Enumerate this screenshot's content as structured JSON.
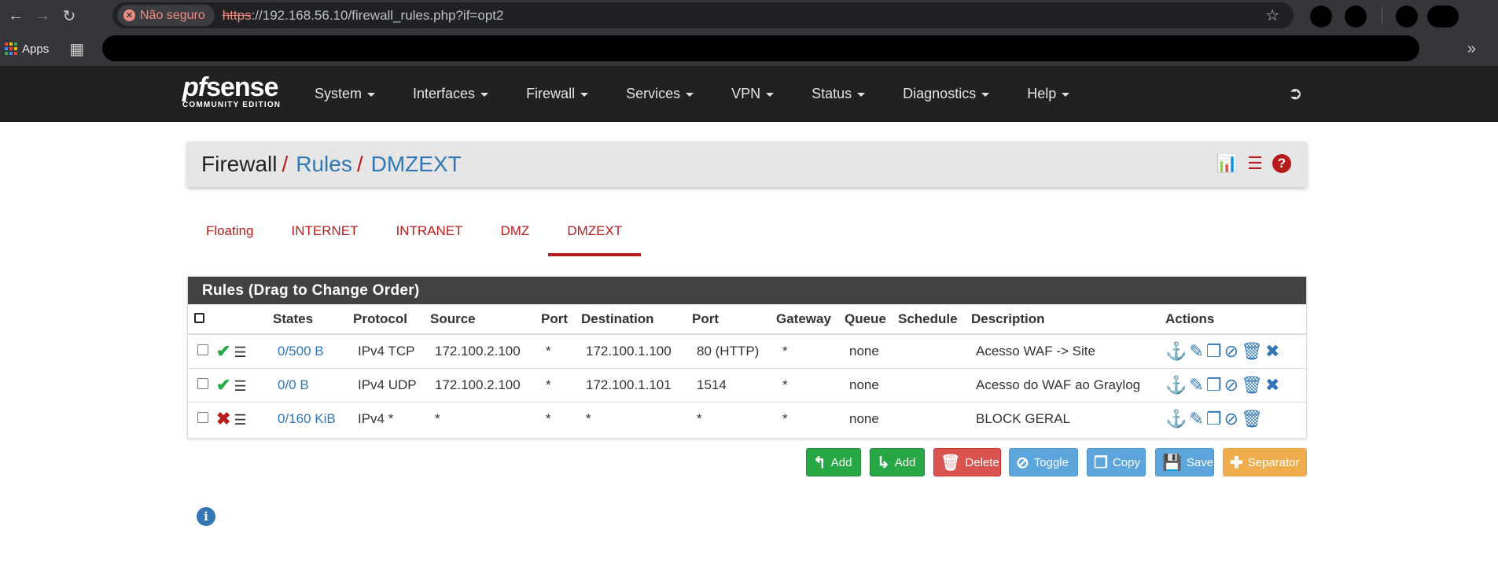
{
  "browser": {
    "security_label": "Não seguro",
    "url_scheme": "https",
    "url_rest": "://192.168.56.10/firewall_rules.php?if=opt2",
    "bookmarks_apps": "Apps"
  },
  "nav": {
    "logo_text_pf": "pf",
    "logo_text_sense": "sense",
    "logo_edition": "COMMUNITY EDITION",
    "menu": [
      "System",
      "Interfaces",
      "Firewall",
      "Services",
      "VPN",
      "Status",
      "Diagnostics",
      "Help"
    ]
  },
  "breadcrumb": {
    "root": "Firewall",
    "level1": "Rules",
    "level2": "DMZEXT"
  },
  "tabs": [
    "Floating",
    "INTERNET",
    "INTRANET",
    "DMZ",
    "DMZEXT"
  ],
  "active_tab": "DMZEXT",
  "rules_panel": {
    "title": "Rules (Drag to Change Order)",
    "columns": [
      "States",
      "Protocol",
      "Source",
      "Port",
      "Destination",
      "Port",
      "Gateway",
      "Queue",
      "Schedule",
      "Description",
      "Actions"
    ],
    "rows": [
      {
        "enabled": "pass",
        "states": "0/500 B",
        "protocol": "IPv4 TCP",
        "source": "172.100.2.100",
        "sport": "*",
        "destination": "172.100.1.100",
        "dport": "80 (HTTP)",
        "gateway": "*",
        "queue": "none",
        "schedule": "",
        "description": "Acesso WAF -> Site"
      },
      {
        "enabled": "pass",
        "states": "0/0 B",
        "protocol": "IPv4 UDP",
        "source": "172.100.2.100",
        "sport": "*",
        "destination": "172.100.1.101",
        "dport": "1514",
        "gateway": "*",
        "queue": "none",
        "schedule": "",
        "description": "Acesso do WAF ao Graylog"
      },
      {
        "enabled": "block",
        "states": "0/160 KiB",
        "protocol": "IPv4 *",
        "source": "*",
        "sport": "*",
        "destination": "*",
        "dport": "*",
        "gateway": "*",
        "queue": "none",
        "schedule": "",
        "description": "BLOCK GERAL"
      }
    ]
  },
  "buttons": {
    "add_top": "Add",
    "add_bottom": "Add",
    "delete": "Delete",
    "toggle": "Toggle",
    "copy": "Copy",
    "save": "Save",
    "separator": "Separator"
  },
  "colors": {
    "navbar": "#212121",
    "accent_red": "#b71c1c",
    "link_blue": "#3277b3",
    "pass_green": "#28a745"
  }
}
